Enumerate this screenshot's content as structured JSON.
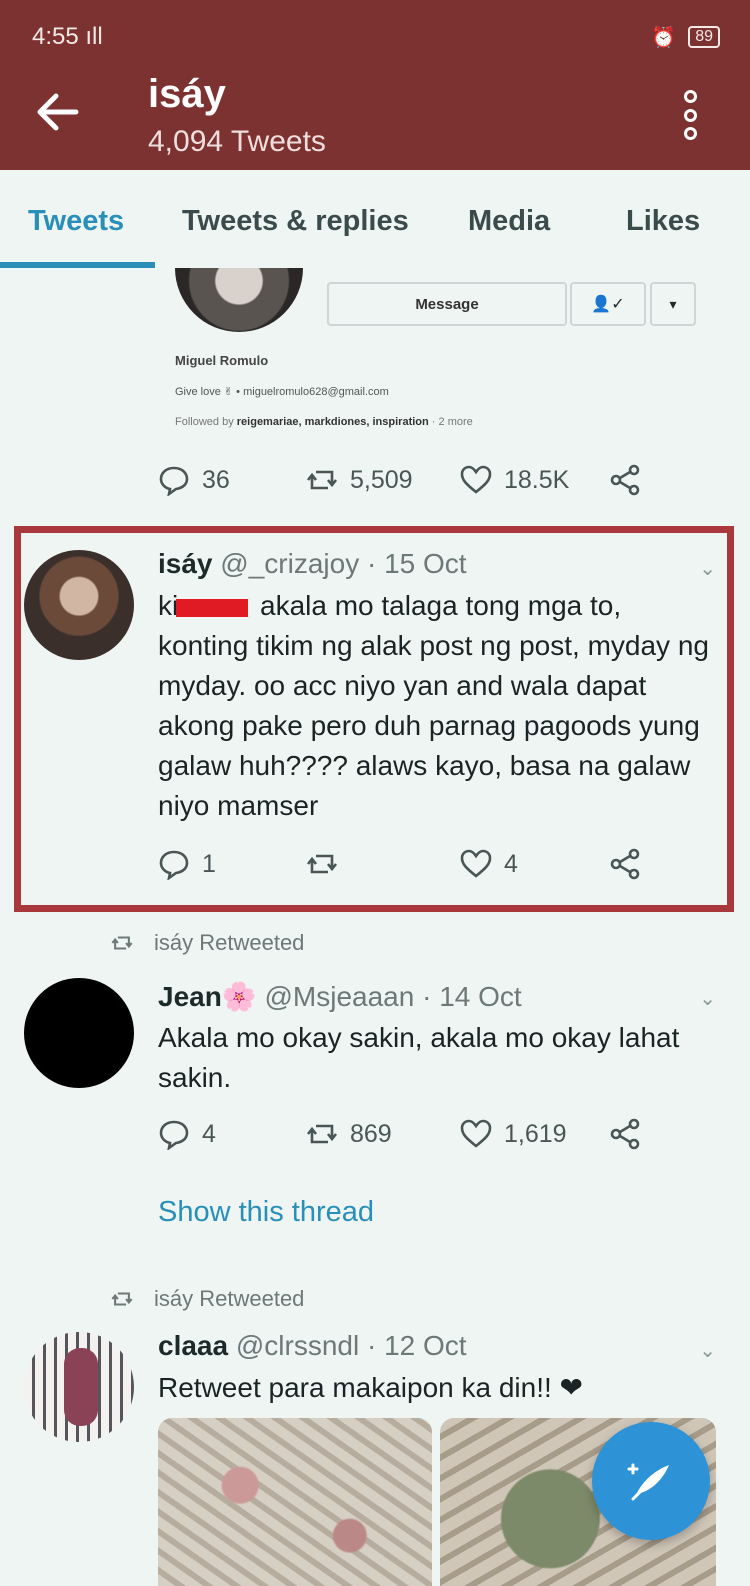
{
  "status_bar": {
    "time": "4:55",
    "signal": "ıll",
    "battery": "89"
  },
  "header": {
    "title": "isáy",
    "subtitle": "4,094 Tweets"
  },
  "tabs": [
    "Tweets",
    "Tweets & replies",
    "Media",
    "Likes"
  ],
  "pinned_profile": {
    "message_label": "Message",
    "name": "Miguel Romulo",
    "bio": "Give love ✌ • miguelromulo628@gmail.com",
    "followed_prefix": "Followed by",
    "followed_names": "reigemariae, markdiones, inspiration",
    "followed_more": "· 2 more"
  },
  "first_actions": {
    "replies": "36",
    "retweets": "5,509",
    "likes": "18.5K"
  },
  "tweets": [
    {
      "name": "isáy",
      "handle": "@_crizajoy",
      "date": "· 15 Oct",
      "text_prefix": "ki",
      "text_rest": " akala mo talaga tong mga to, konting tikim ng alak post ng post, myday ng myday. oo acc niyo yan and wala dapat akong pake pero duh parnag pagoods yung galaw huh???? alaws kayo, basa na galaw niyo mamser",
      "replies": "1",
      "retweets": "",
      "likes": "4"
    },
    {
      "retweeted_by": "isáy Retweeted",
      "name": "Jean",
      "name_emoji": "🌸",
      "handle": "@Msjeaaan",
      "date": "· 14 Oct",
      "text": "Akala mo okay sakin, akala mo okay lahat sakin.",
      "replies": "4",
      "retweets": "869",
      "likes": "1,619",
      "show_thread": "Show this thread"
    },
    {
      "retweeted_by": "isáy Retweeted",
      "name": "claaa",
      "handle": "@clrssndl",
      "date": "· 12 Oct",
      "text": "Retweet para makaipon ka din!! ❤"
    }
  ],
  "colors": {
    "header_bg": "#7c3230",
    "accent": "#2a8fb8",
    "highlight_border": "#a8383b",
    "fab": "#2d93d6"
  }
}
